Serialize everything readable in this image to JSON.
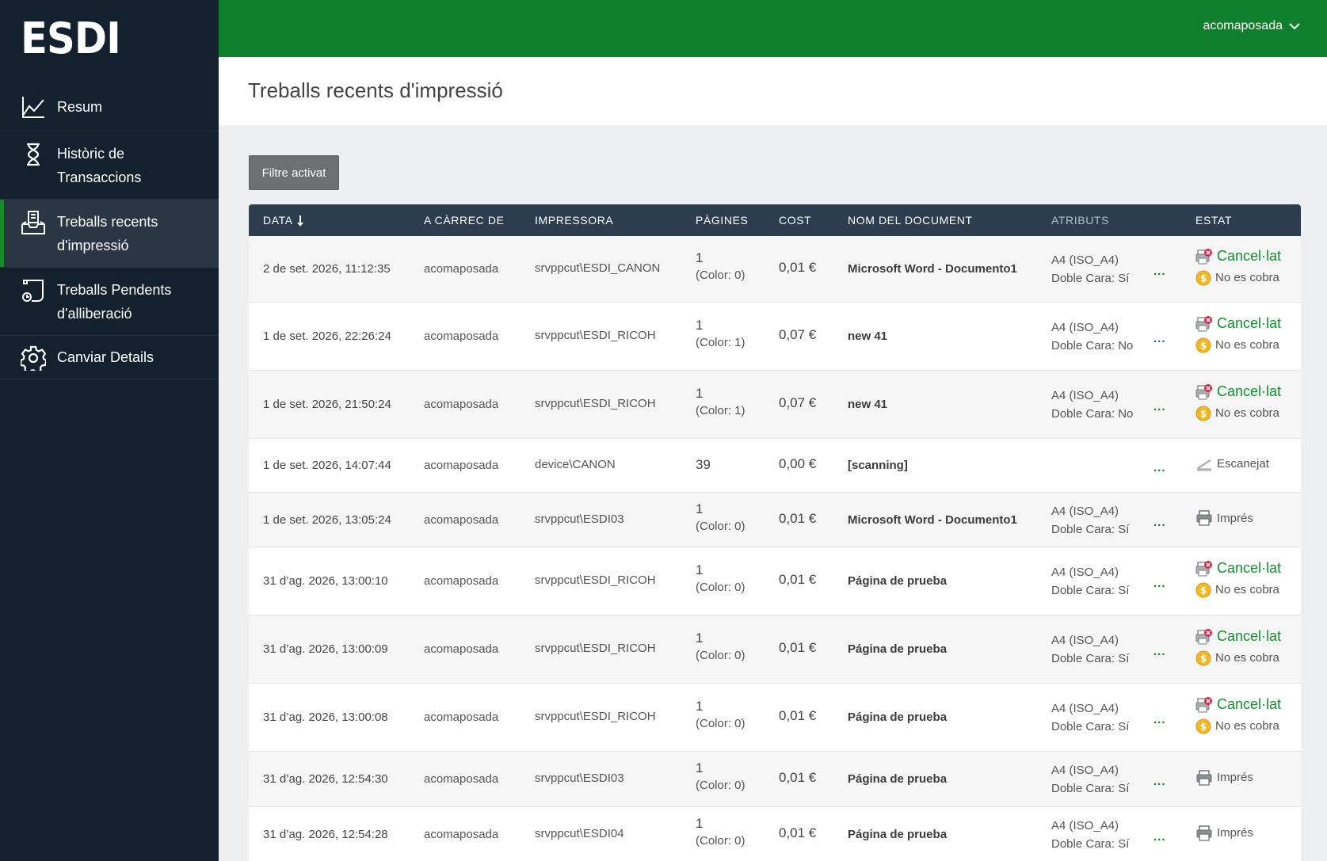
{
  "app": {
    "logo": "ESDI"
  },
  "colors": {
    "sidebar": "#13202e",
    "topbar": "#0e7f2d",
    "accent": "#17882e",
    "table_header": "#2c3d4f",
    "cancel_text": "#15902f"
  },
  "sidebar": {
    "items": [
      {
        "label": "Resum",
        "icon": "line-chart-icon"
      },
      {
        "label": "Històric de Transaccions",
        "icon": "hourglass-icon"
      },
      {
        "label": "Treballs recents d'impressió",
        "icon": "inbox-tray-icon",
        "active": true
      },
      {
        "label": "Treballs Pendents d'alliberació",
        "icon": "pending-document-icon"
      },
      {
        "label": "Canviar Details",
        "icon": "gear-icon"
      }
    ]
  },
  "topbar": {
    "user": "acomaposada"
  },
  "page": {
    "title": "Treballs recents d'impressió",
    "filter_button": "Filtre activat"
  },
  "table": {
    "headers": {
      "date": "DATA",
      "charged_to": "A CÀRREC DE",
      "printer": "IMPRESSORA",
      "pages": "PÀGINES",
      "cost": "COST",
      "document": "NOM DEL DOCUMENT",
      "attributes": "ATRIBUTS",
      "status": "ESTAT"
    },
    "more_label": "...",
    "rows": [
      {
        "date": "2 de set. 2026, 11:12:35",
        "user": "acomaposada",
        "printer": "srvppcut\\ESDI_CANON",
        "pages": "1",
        "color": "(Color: 0)",
        "cost": "0,01 €",
        "document": "Microsoft Word - Documento1",
        "paper": "A4 (ISO_A4)",
        "duplex": "Doble Cara: Sí",
        "status": "Cancel·lat",
        "charge": "No es cobra"
      },
      {
        "date": "1 de set. 2026, 22:26:24",
        "user": "acomaposada",
        "printer": "srvppcut\\ESDI_RICOH",
        "pages": "1",
        "color": "(Color: 1)",
        "cost": "0,07 €",
        "document": "new 41",
        "paper": "A4 (ISO_A4)",
        "duplex": "Doble Cara: No",
        "status": "Cancel·lat",
        "charge": "No es cobra"
      },
      {
        "date": "1 de set. 2026, 21:50:24",
        "user": "acomaposada",
        "printer": "srvppcut\\ESDI_RICOH",
        "pages": "1",
        "color": "(Color: 1)",
        "cost": "0,07 €",
        "document": "new 41",
        "paper": "A4 (ISO_A4)",
        "duplex": "Doble Cara: No",
        "status": "Cancel·lat",
        "charge": "No es cobra"
      },
      {
        "date": "1 de set. 2026, 14:07:44",
        "user": "acomaposada",
        "printer": "device\\CANON",
        "pages": "39",
        "color": "",
        "cost": "0,00 €",
        "document": "[scanning]",
        "paper": "",
        "duplex": "",
        "status": "Escanejat",
        "charge": ""
      },
      {
        "date": "1 de set. 2026, 13:05:24",
        "user": "acomaposada",
        "printer": "srvppcut\\ESDI03",
        "pages": "1",
        "color": "(Color: 0)",
        "cost": "0,01 €",
        "document": "Microsoft Word - Documento1",
        "paper": "A4 (ISO_A4)",
        "duplex": "Doble Cara: Sí",
        "status": "Imprés",
        "charge": ""
      },
      {
        "date": "31 d’ag. 2026, 13:00:10",
        "user": "acomaposada",
        "printer": "srvppcut\\ESDI_RICOH",
        "pages": "1",
        "color": "(Color: 0)",
        "cost": "0,01 €",
        "document": "Página de prueba",
        "paper": "A4 (ISO_A4)",
        "duplex": "Doble Cara: Sí",
        "status": "Cancel·lat",
        "charge": "No es cobra"
      },
      {
        "date": "31 d’ag. 2026, 13:00:09",
        "user": "acomaposada",
        "printer": "srvppcut\\ESDI_RICOH",
        "pages": "1",
        "color": "(Color: 0)",
        "cost": "0,01 €",
        "document": "Página de prueba",
        "paper": "A4 (ISO_A4)",
        "duplex": "Doble Cara: Sí",
        "status": "Cancel·lat",
        "charge": "No es cobra"
      },
      {
        "date": "31 d’ag. 2026, 13:00:08",
        "user": "acomaposada",
        "printer": "srvppcut\\ESDI_RICOH",
        "pages": "1",
        "color": "(Color: 0)",
        "cost": "0,01 €",
        "document": "Página de prueba",
        "paper": "A4 (ISO_A4)",
        "duplex": "Doble Cara: Sí",
        "status": "Cancel·lat",
        "charge": "No es cobra"
      },
      {
        "date": "31 d’ag. 2026, 12:54:30",
        "user": "acomaposada",
        "printer": "srvppcut\\ESDI03",
        "pages": "1",
        "color": "(Color: 0)",
        "cost": "0,01 €",
        "document": "Página de prueba",
        "paper": "A4 (ISO_A4)",
        "duplex": "Doble Cara: Sí",
        "status": "Imprés",
        "charge": ""
      },
      {
        "date": "31 d’ag. 2026, 12:54:28",
        "user": "acomaposada",
        "printer": "srvppcut\\ESDI04",
        "pages": "1",
        "color": "(Color: 0)",
        "cost": "0,01 €",
        "document": "Página de prueba",
        "paper": "A4 (ISO_A4)",
        "duplex": "Doble Cara: Sí",
        "status": "Imprés",
        "charge": ""
      }
    ]
  }
}
